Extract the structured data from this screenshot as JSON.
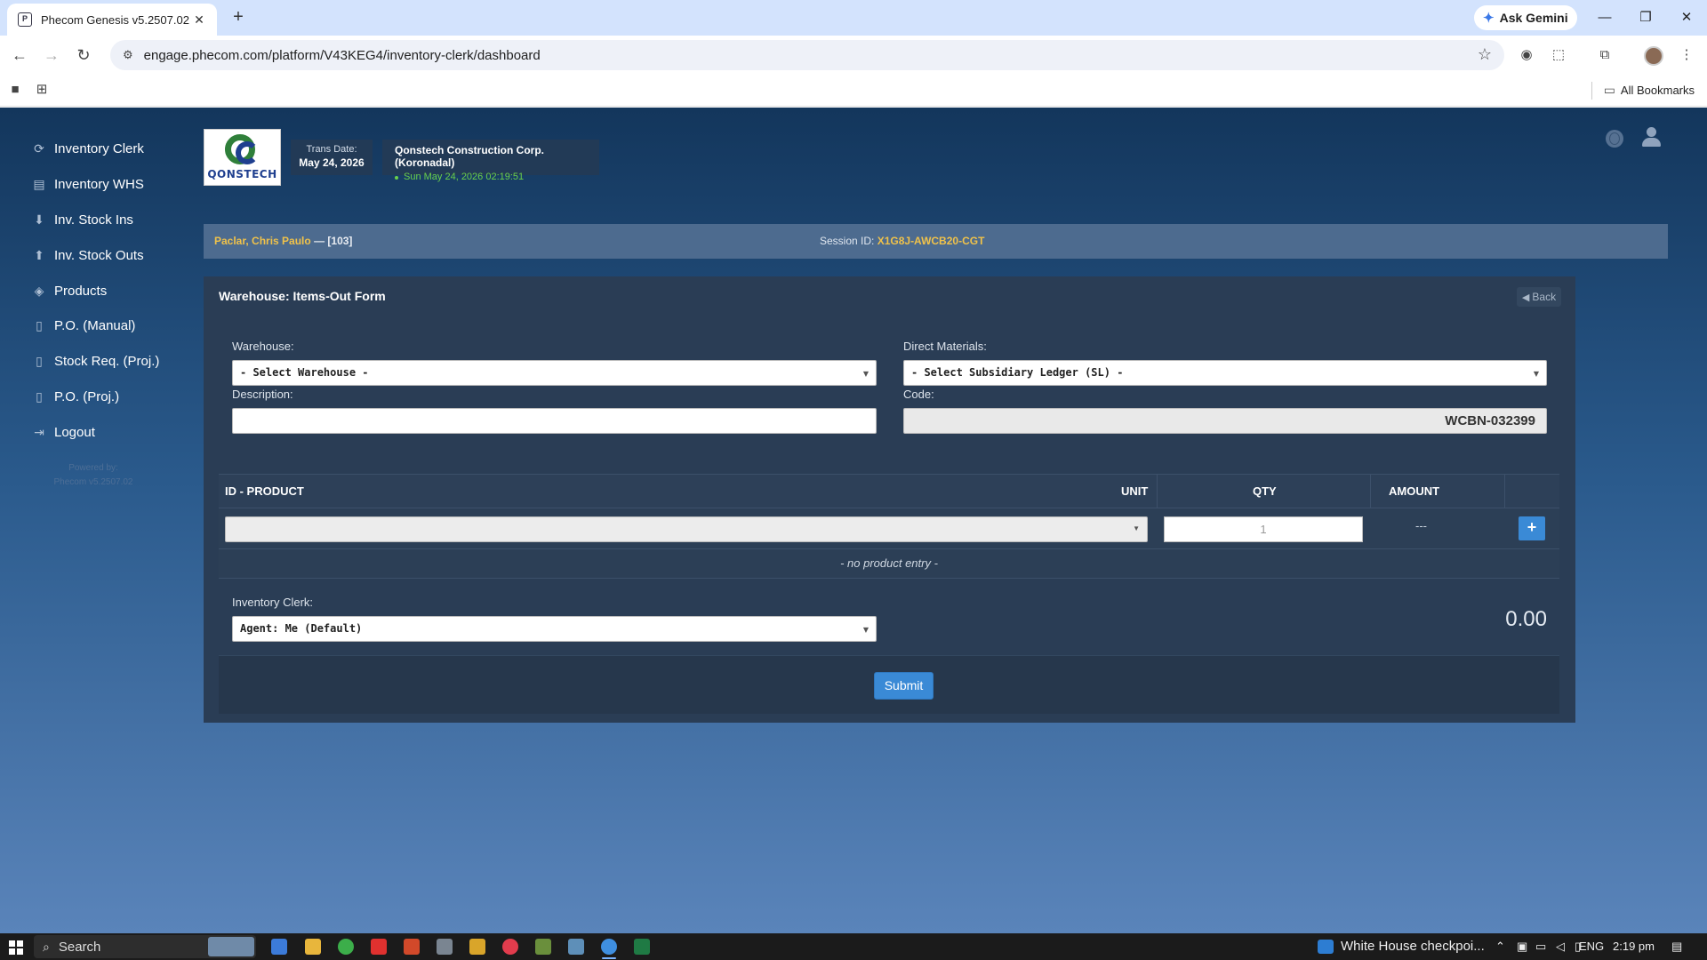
{
  "browser": {
    "tab_title": "Phecom Genesis v5.2507.02",
    "url": "engage.phecom.com/platform/V43KEG4/inventory-clerk/dashboard",
    "ask_gemini": "Ask Gemini",
    "all_bookmarks": "All Bookmarks"
  },
  "sidebar": {
    "items": [
      {
        "label": "Inventory Clerk",
        "icon": "refresh-icon"
      },
      {
        "label": "Inventory WHS",
        "icon": "box-icon"
      },
      {
        "label": "Inv. Stock Ins",
        "icon": "arrow-down-circle-icon"
      },
      {
        "label": "Inv. Stock Outs",
        "icon": "arrow-up-circle-icon"
      },
      {
        "label": "Products",
        "icon": "cube-icon"
      },
      {
        "label": "P.O. (Manual)",
        "icon": "document-icon"
      },
      {
        "label": "Stock Req. (Proj.)",
        "icon": "document-icon"
      },
      {
        "label": "P.O. (Proj.)",
        "icon": "document-icon"
      },
      {
        "label": "Logout",
        "icon": "logout-icon"
      }
    ],
    "powered_by": "Powered by:",
    "version": "Phecom v5.2507.02"
  },
  "header": {
    "logo_text": "QONSTECH",
    "trans_label": "Trans Date:",
    "trans_date": "May 24, 2026",
    "company": "Qonstech Construction Corp. (Koronadal)",
    "datetime": "Sun May 24, 2026 02:19:51"
  },
  "session": {
    "user": "Paclar, Chris Paulo",
    "user_code": "— [103]",
    "id_label": "Session ID:",
    "id_value": "X1G8J-AWCB20-CGT"
  },
  "form": {
    "title": "Warehouse: Items-Out Form",
    "back": "Back",
    "warehouse_label": "Warehouse:",
    "warehouse_value": "- Select Warehouse -",
    "direct_materials_label": "Direct Materials:",
    "direct_materials_value": "- Select Subsidiary Ledger (SL) -",
    "description_label": "Description:",
    "description_value": "",
    "code_label": "Code:",
    "code_value": "WCBN-032399",
    "table": {
      "headers": [
        "ID - PRODUCT",
        "UNIT",
        "QTY",
        "AMOUNT"
      ],
      "qty_placeholder": "1",
      "amount": "---",
      "add_label": "+",
      "empty_text": "- no product entry -"
    },
    "clerk_label": "Inventory Clerk:",
    "clerk_value": "Agent: Me (Default)",
    "total": "0.00",
    "submit": "Submit"
  },
  "taskbar": {
    "search": "Search",
    "news": "White House checkpoi...",
    "lang": "ENG",
    "time": "2:19 pm"
  }
}
